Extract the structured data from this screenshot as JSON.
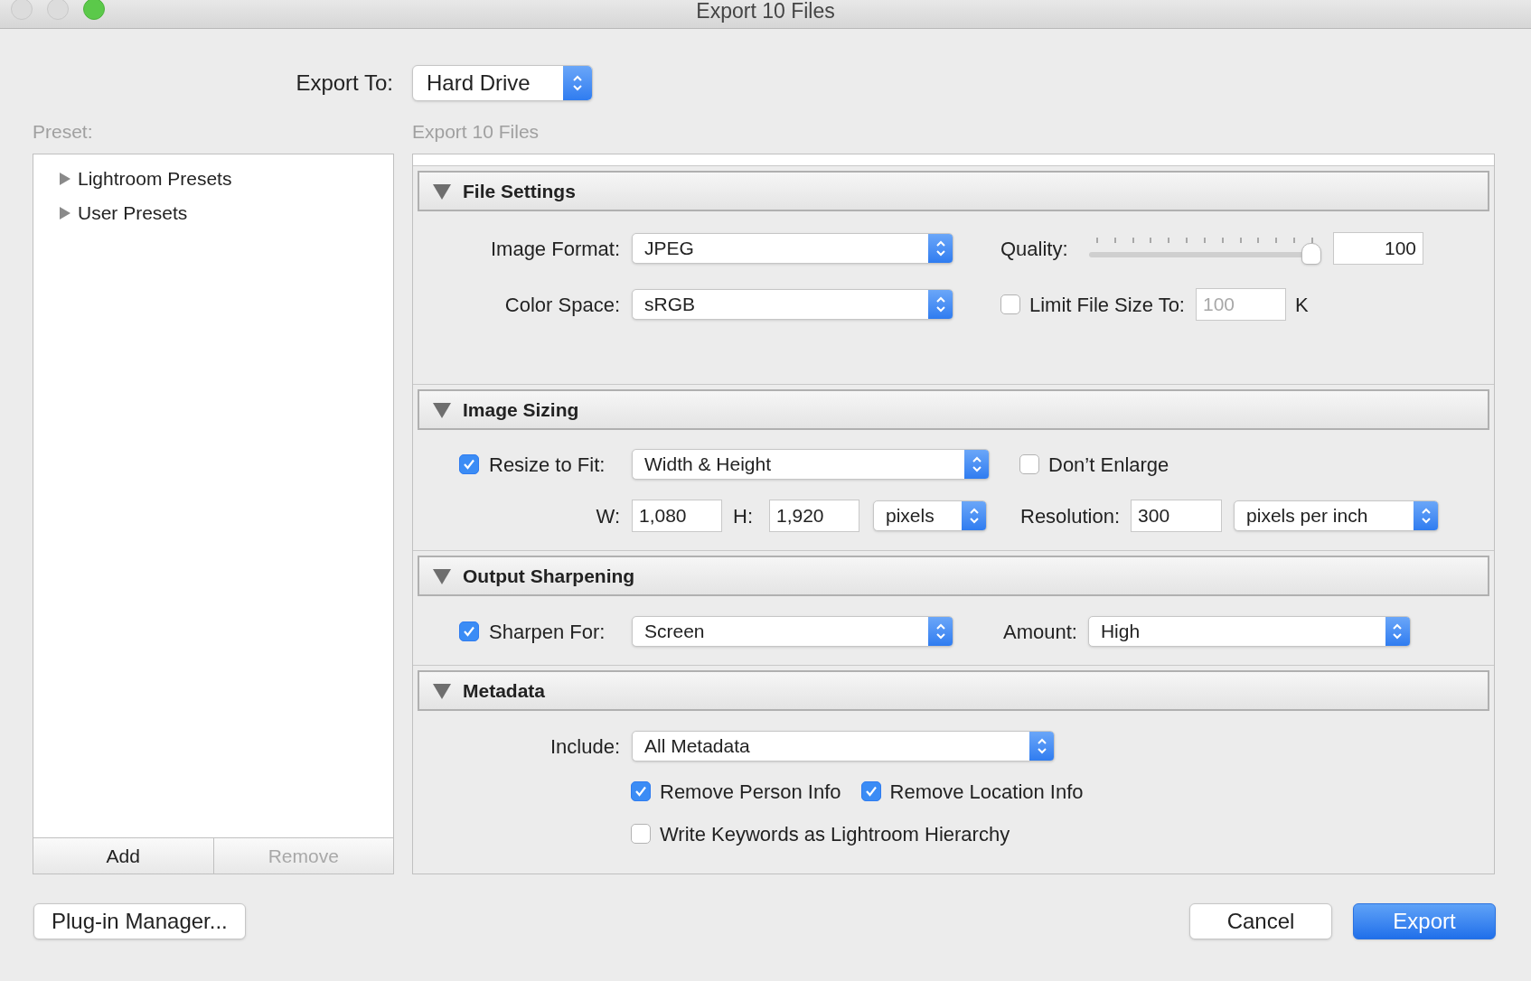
{
  "window": {
    "title": "Export 10 Files"
  },
  "export_to": {
    "label": "Export To:",
    "value": "Hard Drive"
  },
  "preset": {
    "label": "Preset:",
    "items": [
      {
        "label": "Lightroom Presets",
        "expanded": false
      },
      {
        "label": "User Presets",
        "expanded": false
      }
    ],
    "buttons": [
      {
        "label": "Add",
        "disabled": false
      },
      {
        "label": "Remove",
        "disabled": true
      }
    ]
  },
  "panel_title": "Export 10 Files",
  "sections": [
    {
      "kind": "file_settings",
      "title": "File Settings",
      "expanded": true,
      "image_format": {
        "label": "Image Format:",
        "value": "JPEG"
      },
      "color_space": {
        "label": "Color Space:",
        "value": "sRGB"
      },
      "quality": {
        "label": "Quality:",
        "level": 1,
        "value": "100"
      },
      "limit_file_size": {
        "label": "Limit File Size To:",
        "checked": false,
        "value": "100",
        "unit": "K"
      }
    },
    {
      "kind": "image_sizing",
      "title": "Image Sizing",
      "expanded": true,
      "resize_to_fit": {
        "label": "Resize to Fit:",
        "checked": true,
        "value": "Width & Height"
      },
      "dont_enlarge": {
        "label": "Don’t Enlarge",
        "checked": false
      },
      "width": {
        "label": "W:",
        "value": "1,080"
      },
      "height": {
        "label": "H:",
        "value": "1,920"
      },
      "units": "pixels",
      "resolution": {
        "label": "Resolution:",
        "value": "300",
        "units": "pixels per inch"
      }
    },
    {
      "kind": "output_sharpening",
      "title": "Output Sharpening",
      "expanded": true,
      "sharpen_for": {
        "label": "Sharpen For:",
        "checked": true,
        "value": "Screen"
      },
      "amount": {
        "label": "Amount:",
        "value": "High"
      }
    },
    {
      "kind": "metadata",
      "title": "Metadata",
      "expanded": true,
      "include": {
        "label": "Include:",
        "value": "All Metadata"
      },
      "options": [
        {
          "label": "Remove Person Info",
          "checked": true
        },
        {
          "label": "Remove Location Info",
          "checked": true
        },
        {
          "label": "Write Keywords as Lightroom Hierarchy",
          "checked": false
        }
      ]
    }
  ],
  "footer": {
    "left_button": "Plug-in Manager...",
    "buttons": [
      {
        "label": "Cancel",
        "default": false
      },
      {
        "label": "Export",
        "default": true
      }
    ]
  }
}
